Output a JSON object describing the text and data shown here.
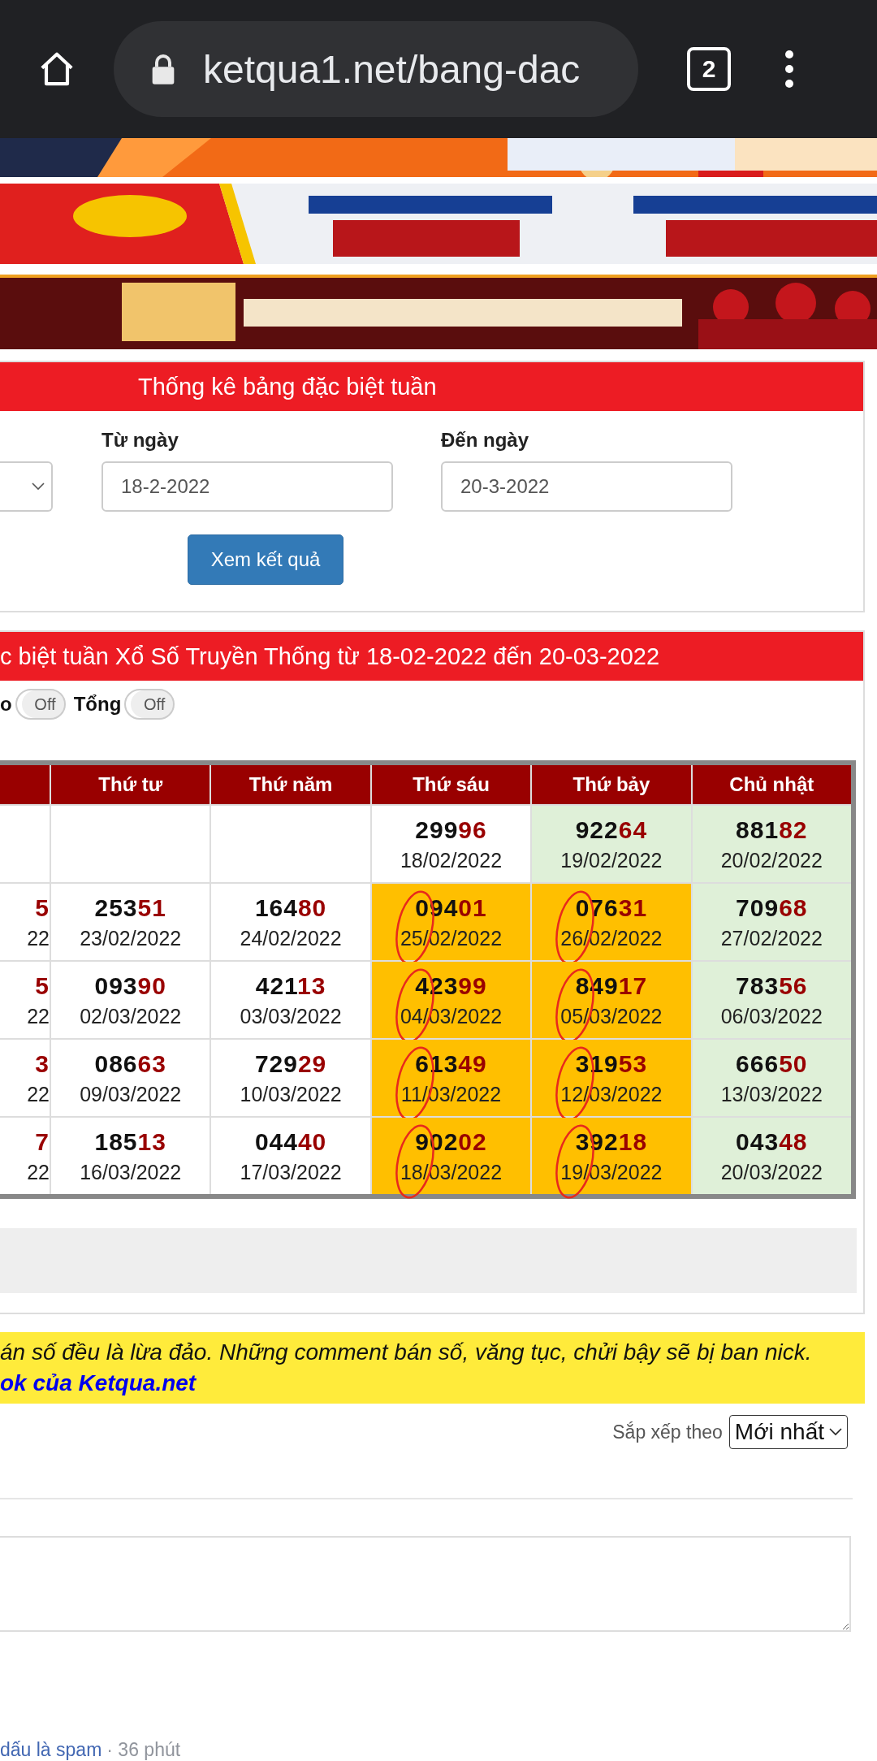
{
  "browser": {
    "url": "ketqua1.net/bang-dac",
    "tab_count": "2"
  },
  "filter_panel": {
    "title": "Thống kê bảng đặc biệt tuần",
    "from_label": "Từ ngày",
    "from_value": "18-2-2022",
    "to_label": "Đến ngày",
    "to_value": "20-3-2022",
    "submit": "Xem kết quả"
  },
  "results_panel": {
    "title": "c biệt tuần Xổ Số Truyền Thống từ 18-02-2022 đến 20-03-2022",
    "toggles": [
      {
        "label": "o",
        "state": "Off",
        "on": false
      },
      {
        "label": "Tổng",
        "state": "Off",
        "on": false
      }
    ],
    "columns": [
      "",
      "Thứ tư",
      "Thứ năm",
      "Thứ sáu",
      "Thứ bảy",
      "Chủ nhật"
    ],
    "rows": [
      [
        {
          "color": "#ffffff"
        },
        {
          "color": "#ffffff"
        },
        {
          "color": "#ffffff"
        },
        {
          "color": "#ffffff",
          "head": "299",
          "tail": "96",
          "date": "18/02/2022",
          "circled": false
        },
        {
          "color": "#dff0d8",
          "head": "922",
          "tail": "64",
          "date": "19/02/2022",
          "circled": false
        },
        {
          "color": "#dff0d8",
          "head": "881",
          "tail": "82",
          "date": "20/02/2022",
          "circled": false
        }
      ],
      [
        {
          "color": "#ffffff",
          "tail": "5",
          "date": "22"
        },
        {
          "color": "#ffffff",
          "head": "253",
          "tail": "51",
          "date": "23/02/2022",
          "circled": false
        },
        {
          "color": "#ffffff",
          "head": "164",
          "tail": "80",
          "date": "24/02/2022",
          "circled": false
        },
        {
          "color": "#ffbf00",
          "head": "094",
          "tail": "01",
          "date": "25/02/2022",
          "circled": true
        },
        {
          "color": "#ffbf00",
          "head": "076",
          "tail": "31",
          "date": "26/02/2022",
          "circled": true
        },
        {
          "color": "#dff0d8",
          "head": "709",
          "tail": "68",
          "date": "27/02/2022",
          "circled": false
        }
      ],
      [
        {
          "color": "#ffffff",
          "tail": "5",
          "date": "22"
        },
        {
          "color": "#ffffff",
          "head": "093",
          "tail": "90",
          "date": "02/03/2022",
          "circled": false
        },
        {
          "color": "#ffffff",
          "head": "421",
          "tail": "13",
          "date": "03/03/2022",
          "circled": false
        },
        {
          "color": "#ffbf00",
          "head": "423",
          "tail": "99",
          "date": "04/03/2022",
          "circled": true
        },
        {
          "color": "#ffbf00",
          "head": "849",
          "tail": "17",
          "date": "05/03/2022",
          "circled": true
        },
        {
          "color": "#dff0d8",
          "head": "783",
          "tail": "56",
          "date": "06/03/2022",
          "circled": false
        }
      ],
      [
        {
          "color": "#ffffff",
          "tail": "3",
          "date": "22"
        },
        {
          "color": "#ffffff",
          "head": "086",
          "tail": "63",
          "date": "09/03/2022",
          "circled": false
        },
        {
          "color": "#ffffff",
          "head": "729",
          "tail": "29",
          "date": "10/03/2022",
          "circled": false
        },
        {
          "color": "#ffbf00",
          "head": "613",
          "tail": "49",
          "date": "11/03/2022",
          "circled": true
        },
        {
          "color": "#ffbf00",
          "head": "319",
          "tail": "53",
          "date": "12/03/2022",
          "circled": true
        },
        {
          "color": "#dff0d8",
          "head": "666",
          "tail": "50",
          "date": "13/03/2022",
          "circled": false
        }
      ],
      [
        {
          "color": "#ffffff",
          "tail": "7",
          "date": "22"
        },
        {
          "color": "#ffffff",
          "head": "185",
          "tail": "13",
          "date": "16/03/2022",
          "circled": false
        },
        {
          "color": "#ffffff",
          "head": "044",
          "tail": "40",
          "date": "17/03/2022",
          "circled": false
        },
        {
          "color": "#ffbf00",
          "head": "902",
          "tail": "02",
          "date": "18/03/2022",
          "circled": true
        },
        {
          "color": "#ffbf00",
          "head": "392",
          "tail": "18",
          "date": "19/03/2022",
          "circled": true
        },
        {
          "color": "#dff0d8",
          "head": "043",
          "tail": "48",
          "date": "20/03/2022",
          "circled": false
        }
      ]
    ]
  },
  "notice": {
    "text": "án số đều là lừa đảo. Những comment bán số, văng tục, chửi bậy sẽ bị ban nick.",
    "link": "ok của Ketqua.net"
  },
  "comments": {
    "sort_label": "Sắp xếp theo",
    "sort_value": "Mới nhất",
    "footer_link": "dấu là spam",
    "footer_time": "· 36 phút"
  }
}
